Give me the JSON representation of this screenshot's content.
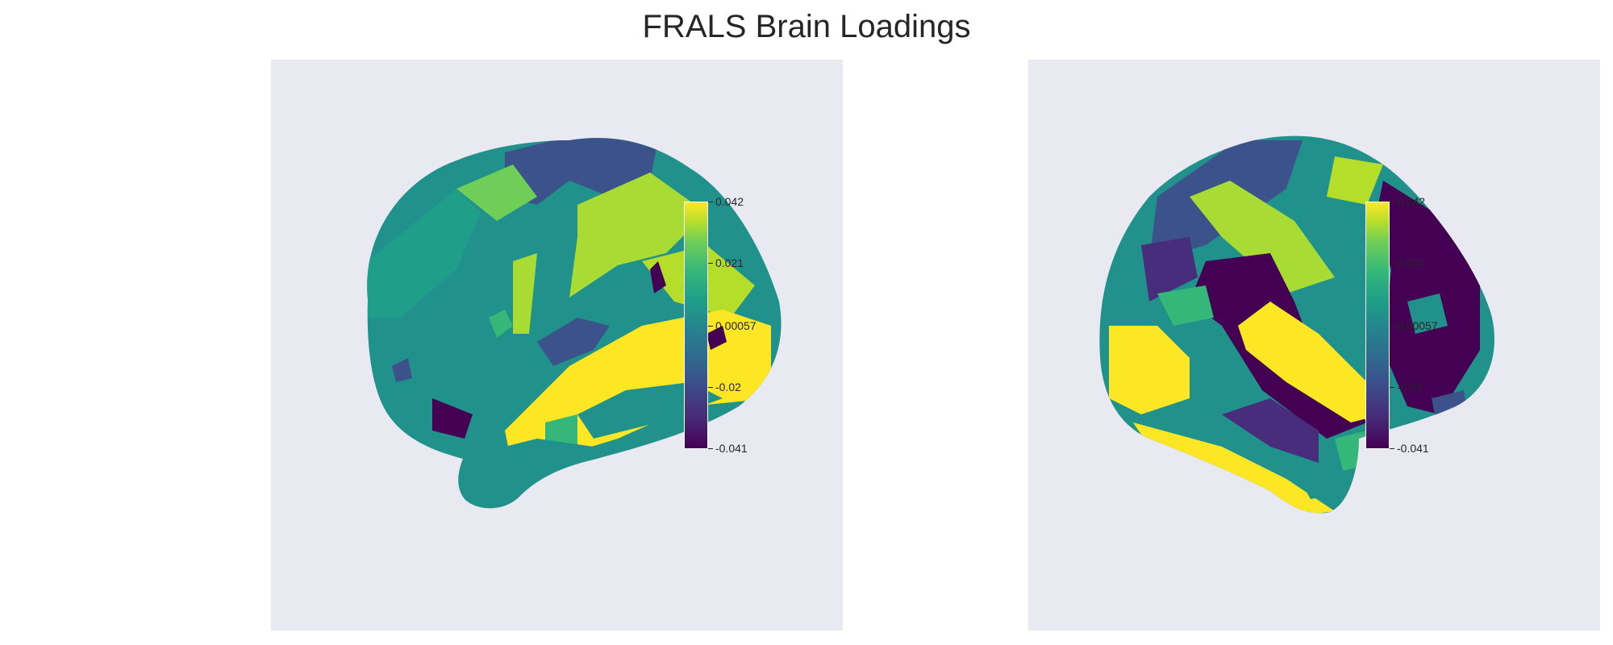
{
  "title": "FRALS Brain Loadings",
  "colormap": "viridis",
  "colorbar": {
    "ticks": [
      "0.042",
      "0.021",
      "0.00057",
      "-0.02",
      "-0.041"
    ],
    "min": -0.041,
    "max": 0.042
  },
  "panels": [
    {
      "view": "left-lateral"
    },
    {
      "view": "right-lateral"
    }
  ],
  "colors": {
    "background": "#e9e9f1",
    "yellow": "#fde725",
    "lime": "#a8db34",
    "green": "#35b779",
    "teal": "#21918c",
    "blue": "#3b528b",
    "indigo": "#472d7b",
    "purple": "#440154"
  }
}
